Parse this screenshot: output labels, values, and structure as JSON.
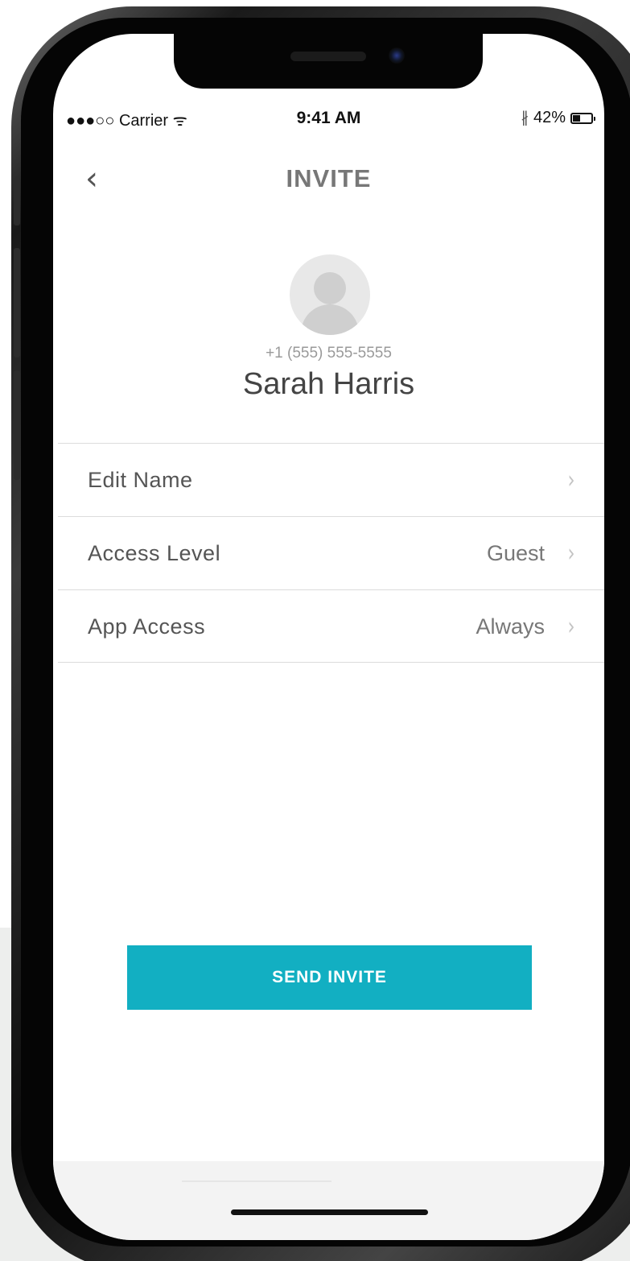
{
  "status_bar": {
    "signal_carrier": "●●●○○ Carrier",
    "wifi_glyph": "ᯤ",
    "time": "9:41 AM",
    "bluetooth_glyph": "∦",
    "battery_percent": "42%",
    "battery_level": 0.42
  },
  "nav": {
    "back_glyph": "‹",
    "title": "INVITE"
  },
  "contact": {
    "phone": "+1 (555) 555-5555",
    "name": "Sarah Harris"
  },
  "settings": [
    {
      "label": "Edit Name",
      "value": ""
    },
    {
      "label": "Access Level",
      "value": "Guest"
    },
    {
      "label": "App Access",
      "value": "Always"
    }
  ],
  "chevron_glyph": "›",
  "send_button_label": "SEND INVITE",
  "colors": {
    "accent": "#12afc2",
    "title_gray": "#777777"
  },
  "icons": [
    "back-chevron-icon",
    "avatar-placeholder-icon",
    "chevron-right-icon",
    "wifi-icon",
    "bluetooth-icon",
    "battery-icon"
  ]
}
